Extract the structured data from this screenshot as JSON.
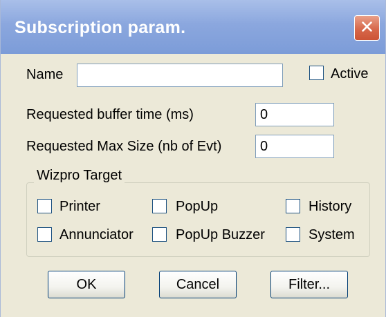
{
  "window": {
    "title": "Subscription param.",
    "close_glyph": "✕"
  },
  "fields": {
    "name_label": "Name",
    "name_value": "",
    "active_label": "Active",
    "active_checked": false,
    "buffer_time_label": "Requested buffer time (ms)",
    "buffer_time_value": "0",
    "max_size_label": "Requested Max Size (nb of Evt)",
    "max_size_value": "0"
  },
  "target_group": {
    "label": "Wizpro Target",
    "options": [
      {
        "label": "Printer",
        "checked": false
      },
      {
        "label": "PopUp",
        "checked": false
      },
      {
        "label": "History",
        "checked": false
      },
      {
        "label": "Annunciator",
        "checked": false
      },
      {
        "label": "PopUp Buzzer",
        "checked": false
      },
      {
        "label": "System",
        "checked": false
      }
    ]
  },
  "buttons": {
    "ok_label": "OK",
    "cancel_label": "Cancel",
    "filter_label": "Filter..."
  },
  "colors": {
    "titlebar": "#8ba7de",
    "dialog_background": "#ece9d8",
    "close_button": "#d7684b",
    "checkbox_border": "#1c5180"
  }
}
